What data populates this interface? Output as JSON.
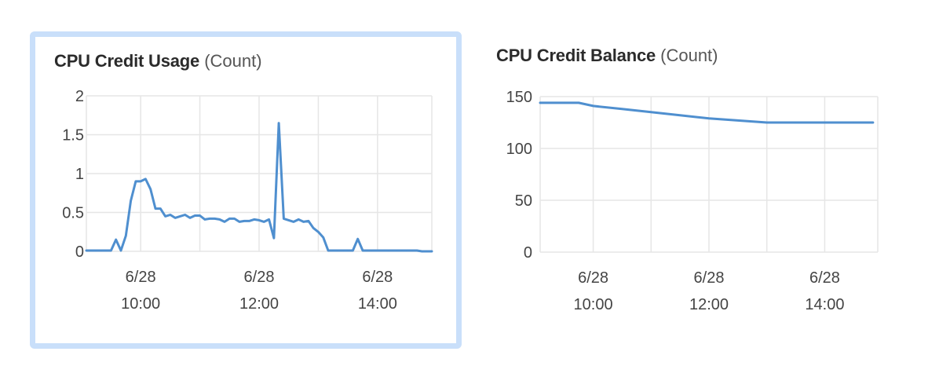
{
  "charts": [
    {
      "title": "CPU Credit Usage",
      "unit": "(Count)"
    },
    {
      "title": "CPU Credit Balance",
      "unit": "(Count)"
    }
  ],
  "chart_data": [
    {
      "type": "line",
      "title": "CPU Credit Usage (Count)",
      "xlabel": "",
      "ylabel": "",
      "ylim": [
        0,
        2
      ],
      "yticks": [
        0,
        0.5,
        1,
        1.5,
        2
      ],
      "ytick_labels": [
        "0",
        "0.5",
        "1",
        "1.5",
        "2"
      ],
      "xlim": [
        "2017-06-28 09:05",
        "2017-06-28 14:55"
      ],
      "xtick_labels": [
        {
          "line1": "6/28",
          "line2": "10:00"
        },
        {
          "line1": "6/28",
          "line2": "12:00"
        },
        {
          "line1": "6/28",
          "line2": "14:00"
        }
      ],
      "grid": true,
      "line_color": "#4f8fcf",
      "series": [
        {
          "x": [
            "09:05",
            "09:10",
            "09:15",
            "09:20",
            "09:25",
            "09:30",
            "09:35",
            "09:40",
            "09:45",
            "09:50",
            "09:55",
            "10:00",
            "10:05",
            "10:10",
            "10:15",
            "10:20",
            "10:25",
            "10:30",
            "10:35",
            "10:40",
            "10:45",
            "10:50",
            "10:55",
            "11:00",
            "11:05",
            "11:10",
            "11:15",
            "11:20",
            "11:25",
            "11:30",
            "11:35",
            "11:40",
            "11:45",
            "11:50",
            "11:55",
            "12:00",
            "12:05",
            "12:10",
            "12:15",
            "12:20",
            "12:25",
            "12:30",
            "12:35",
            "12:40",
            "12:45",
            "12:50",
            "12:55",
            "13:00",
            "13:05",
            "13:10",
            "13:15",
            "13:20",
            "13:25",
            "13:30",
            "13:35",
            "13:40",
            "13:45",
            "13:50",
            "13:55",
            "14:00",
            "14:05",
            "14:10",
            "14:15",
            "14:20",
            "14:25",
            "14:30",
            "14:35",
            "14:40",
            "14:45",
            "14:50",
            "14:55"
          ],
          "values": [
            0.01,
            0.01,
            0.01,
            0.01,
            0.01,
            0.01,
            0.15,
            0.01,
            0.2,
            0.65,
            0.9,
            0.9,
            0.93,
            0.8,
            0.55,
            0.55,
            0.45,
            0.47,
            0.43,
            0.45,
            0.47,
            0.43,
            0.46,
            0.46,
            0.41,
            0.42,
            0.42,
            0.41,
            0.38,
            0.42,
            0.42,
            0.38,
            0.39,
            0.39,
            0.41,
            0.4,
            0.38,
            0.41,
            0.17,
            1.65,
            0.42,
            0.4,
            0.38,
            0.41,
            0.38,
            0.39,
            0.3,
            0.25,
            0.18,
            0.01,
            0.01,
            0.01,
            0.01,
            0.01,
            0.01,
            0.16,
            0.01,
            0.01,
            0.01,
            0.01,
            0.01,
            0.01,
            0.01,
            0.01,
            0.01,
            0.01,
            0.01,
            0.01,
            0.0,
            0.0,
            0.0
          ]
        }
      ]
    },
    {
      "type": "line",
      "title": "CPU Credit Balance (Count)",
      "xlabel": "",
      "ylabel": "",
      "ylim": [
        0,
        150
      ],
      "yticks": [
        0,
        50,
        100,
        150
      ],
      "ytick_labels": [
        "0",
        "50",
        "100",
        "150"
      ],
      "xlim": [
        "2017-06-28 09:05",
        "2017-06-28 14:55"
      ],
      "xtick_labels": [
        {
          "line1": "6/28",
          "line2": "10:00"
        },
        {
          "line1": "6/28",
          "line2": "12:00"
        },
        {
          "line1": "6/28",
          "line2": "14:00"
        }
      ],
      "grid": true,
      "line_color": "#4f8fcf",
      "series": [
        {
          "x": [
            "09:05",
            "09:30",
            "09:45",
            "10:00",
            "10:30",
            "11:00",
            "11:30",
            "12:00",
            "12:30",
            "13:00",
            "13:30",
            "14:00",
            "14:30",
            "14:50"
          ],
          "values": [
            144,
            144,
            144,
            141,
            138,
            135,
            132,
            129,
            127,
            125,
            125,
            125,
            125,
            125
          ]
        }
      ]
    }
  ]
}
